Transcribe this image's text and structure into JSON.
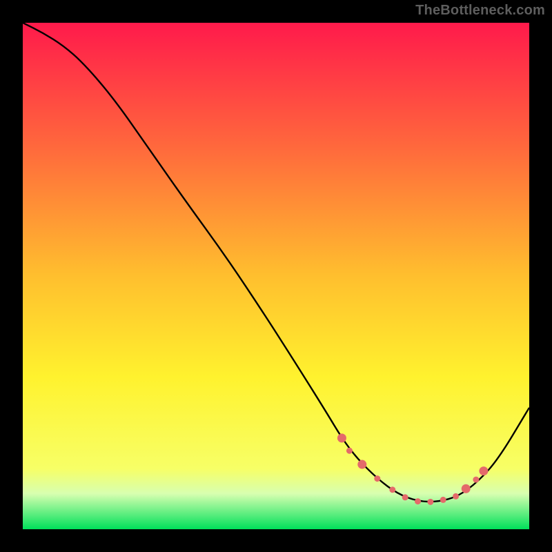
{
  "attribution": "TheBottleneck.com",
  "chart_data": {
    "type": "line",
    "title": "",
    "xlabel": "",
    "ylabel": "",
    "xlim": [
      0,
      100
    ],
    "ylim": [
      0,
      100
    ],
    "grid": false,
    "legend": false,
    "gradient_stops": [
      {
        "offset": 0.0,
        "color": "#ff1a4b"
      },
      {
        "offset": 0.25,
        "color": "#ff6a3c"
      },
      {
        "offset": 0.5,
        "color": "#ffbf2e"
      },
      {
        "offset": 0.7,
        "color": "#fff22e"
      },
      {
        "offset": 0.88,
        "color": "#f7ff66"
      },
      {
        "offset": 0.93,
        "color": "#d7ffb0"
      },
      {
        "offset": 1.0,
        "color": "#00e05a"
      }
    ],
    "series": [
      {
        "name": "curve",
        "color": "#000000",
        "x": [
          0,
          4,
          8,
          12,
          18,
          25,
          32,
          40,
          48,
          55,
          60,
          63,
          66,
          70,
          74,
          78,
          82,
          86,
          90,
          94,
          100
        ],
        "y": [
          100,
          98,
          95.5,
          92,
          85,
          75,
          65,
          54,
          42,
          31,
          23,
          18,
          14,
          10,
          7,
          5.5,
          5.4,
          6.5,
          9.5,
          14,
          24
        ]
      }
    ],
    "markers": {
      "color": "#e46a6a",
      "radius_small": 4.5,
      "radius_large": 6.5,
      "points": [
        {
          "x": 63.0,
          "y": 18.0,
          "r": "large"
        },
        {
          "x": 64.5,
          "y": 15.5,
          "r": "small"
        },
        {
          "x": 67.0,
          "y": 12.8,
          "r": "large"
        },
        {
          "x": 70.0,
          "y": 10.0,
          "r": "small"
        },
        {
          "x": 73.0,
          "y": 7.8,
          "r": "small"
        },
        {
          "x": 75.5,
          "y": 6.3,
          "r": "small"
        },
        {
          "x": 78.0,
          "y": 5.5,
          "r": "small"
        },
        {
          "x": 80.5,
          "y": 5.4,
          "r": "small"
        },
        {
          "x": 83.0,
          "y": 5.8,
          "r": "small"
        },
        {
          "x": 85.5,
          "y": 6.5,
          "r": "small"
        },
        {
          "x": 87.5,
          "y": 8.0,
          "r": "large"
        },
        {
          "x": 89.5,
          "y": 9.8,
          "r": "small"
        },
        {
          "x": 91.0,
          "y": 11.5,
          "r": "large"
        }
      ]
    }
  }
}
